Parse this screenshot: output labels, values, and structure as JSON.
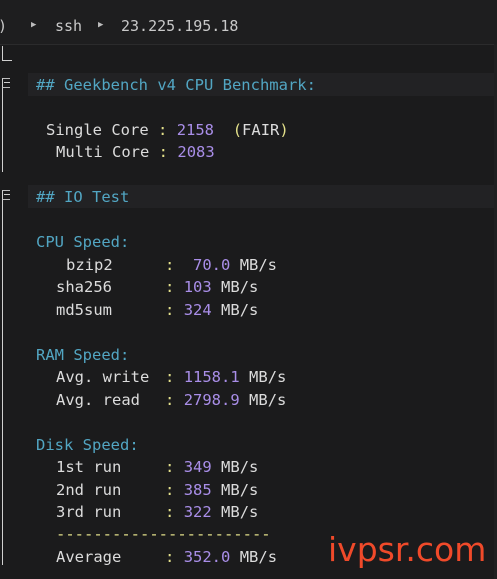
{
  "titlebar": {
    "left_fragment": ")",
    "arrow_icon": "triangle-right-icon",
    "host_label": "ssh",
    "address": "23.225.195.18"
  },
  "geekbench": {
    "heading": "## Geekbench v4 CPU Benchmark:",
    "single_core": {
      "label": "Single Core",
      "value": "2158",
      "rating_open": "(",
      "rating": "FAIR",
      "rating_close": ")"
    },
    "multi_core": {
      "label": "Multi Core",
      "value": "2083"
    }
  },
  "io_test": {
    "heading": "## IO Test",
    "cpu_speed": {
      "heading": "CPU Speed:",
      "rows": [
        {
          "label": "bzip2",
          "value": "70.0",
          "unit": "MB/s"
        },
        {
          "label": "sha256",
          "value": "103",
          "unit": "MB/s"
        },
        {
          "label": "md5sum",
          "value": "324",
          "unit": "MB/s"
        }
      ]
    },
    "ram_speed": {
      "heading": "RAM Speed:",
      "rows": [
        {
          "label": "Avg. write",
          "value": "1158.1",
          "unit": "MB/s"
        },
        {
          "label": "Avg. read",
          "value": "2798.9",
          "unit": "MB/s"
        }
      ]
    },
    "disk_speed": {
      "heading": "Disk Speed:",
      "rows": [
        {
          "label": "1st run",
          "value": "349",
          "unit": "MB/s"
        },
        {
          "label": "2nd run",
          "value": "385",
          "unit": "MB/s"
        },
        {
          "label": "3rd run",
          "value": "322",
          "unit": "MB/s"
        }
      ],
      "rule": "-----------------------",
      "average": {
        "label": "Average",
        "value": "352.0",
        "unit": "MB/s"
      }
    },
    "colon": ":"
  },
  "watermark": "ivpsr.com",
  "colors": {
    "background": "#1b1b1c",
    "heading": "#52a6c3",
    "value": "#a98ee8",
    "colon": "#e3e08a",
    "text": "#dcdcdc",
    "watermark": "#f04a2a"
  }
}
